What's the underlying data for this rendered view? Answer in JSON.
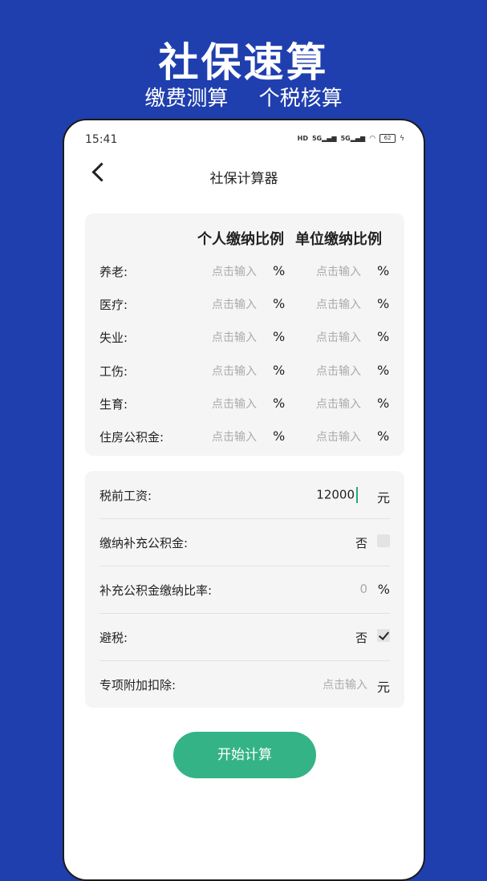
{
  "banner": {
    "title": "社保速算",
    "sub1": "缴费测算",
    "sub2": "个税核算"
  },
  "status": {
    "time": "15:41",
    "net1": "5G",
    "net2": "5G",
    "battery": "62"
  },
  "nav": {
    "title": "社保计算器"
  },
  "ratio_card": {
    "col_personal": "个人缴纳比例",
    "col_company": "单位缴纳比例",
    "placeholder": "点击输入",
    "unit": "%",
    "rows": [
      {
        "label": "养老:"
      },
      {
        "label": "医疗:"
      },
      {
        "label": "失业:"
      },
      {
        "label": "工伤:"
      },
      {
        "label": "生育:"
      },
      {
        "label": "住房公积金:"
      }
    ]
  },
  "form": {
    "salary_label": "税前工资:",
    "salary_value": "12000",
    "salary_unit": "元",
    "supp_fund_label": "缴纳补充公积金:",
    "supp_fund_value": "否",
    "supp_fund_checked": false,
    "supp_rate_label": "补充公积金缴纳比率:",
    "supp_rate_value": "0",
    "supp_rate_unit": "%",
    "tax_avoid_label": "避税:",
    "tax_avoid_value": "否",
    "tax_avoid_checked": true,
    "deduction_label": "专项附加扣除:",
    "deduction_placeholder": "点击输入",
    "deduction_unit": "元"
  },
  "button": {
    "label": "开始计算"
  }
}
